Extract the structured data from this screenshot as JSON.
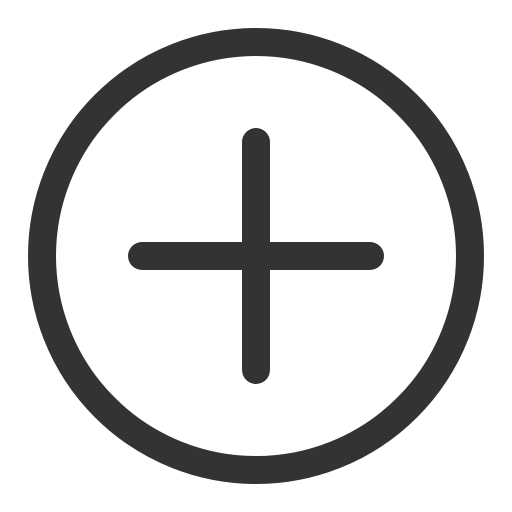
{
  "icon": {
    "name": "plus-circle-icon",
    "stroke_color": "#333333",
    "background_color": "#ffffff"
  }
}
